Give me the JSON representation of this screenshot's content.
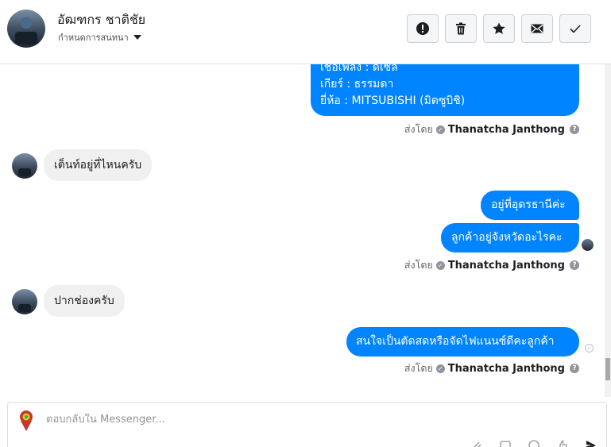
{
  "header": {
    "contact_name": "อัฒฑกร ชาติชัย",
    "assign_label": "กำหนดการสนทนา",
    "actions": [
      {
        "icon": "alert-icon"
      },
      {
        "icon": "trash-icon"
      },
      {
        "icon": "star-icon"
      },
      {
        "icon": "envelope-icon"
      },
      {
        "icon": "check-icon"
      }
    ]
  },
  "messages": {
    "m1": {
      "lines": [
        "เชื้อเพลิง : ดีเซล",
        "เกียร์ : ธรรมดา",
        "ยี่ห้อ : MITSUBISHI (มิตซูบิชิ)"
      ]
    },
    "sender1": {
      "prefix": "ส่งโดย",
      "name": "Thanatcha Janthong"
    },
    "m2": "เต็นท์อยู่ที่ไหนครับ",
    "m3": "อยู่ที่อุดรธานีค่ะ",
    "m4": "ลูกค้าอยู่จังหวัดอะไรคะ",
    "sender2": {
      "prefix": "ส่งโดย",
      "name": "Thanatcha Janthong"
    },
    "m5": "ปากช่องครับ",
    "m6": "สนใจเป็นตัดสดหรือจัดไฟแนนซ์ดีคะลูกค้า",
    "sender3": {
      "prefix": "ส่งโดย",
      "name": "Thanatcha Janthong"
    }
  },
  "composer": {
    "placeholder": "ตอบกลับใน Messenger..."
  },
  "colors": {
    "outgoing_bubble": "#0084ff",
    "incoming_bubble": "#f1f0f0"
  }
}
